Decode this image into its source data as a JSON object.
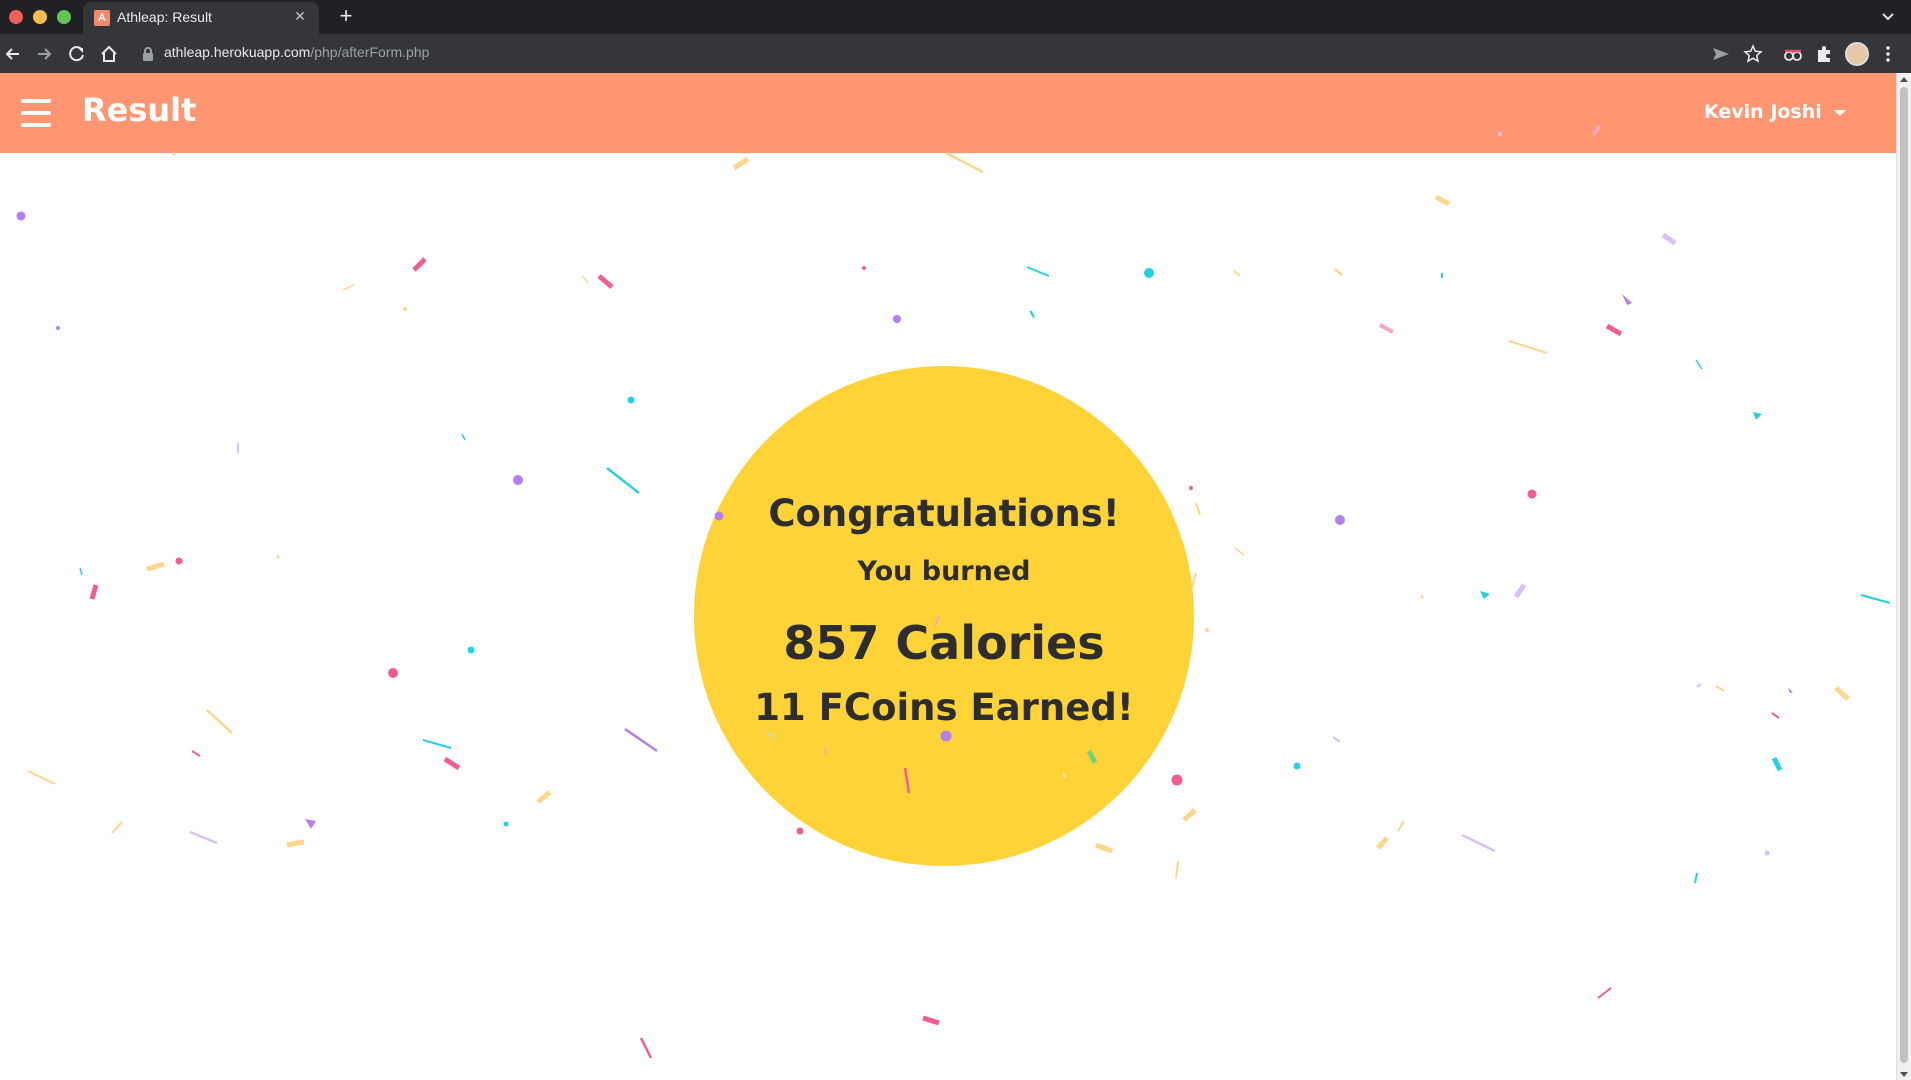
{
  "browser": {
    "tab": {
      "favicon_letter": "A",
      "title": "Athleap: Result",
      "close_symbol": "✕"
    },
    "new_tab_symbol": "+",
    "address": {
      "host": "athleap.herokuapp.com",
      "path": "/php/afterForm.php"
    },
    "toolbar_icons": [
      "back-icon",
      "forward-icon",
      "reload-icon",
      "home-icon",
      "lock-icon",
      "send-icon",
      "star-icon",
      "incognito-extension-icon",
      "extensions-puzzle-icon",
      "profile-avatar",
      "more-menu-icon"
    ]
  },
  "header": {
    "title": "Result",
    "user_name": "Kevin Joshi",
    "menu_icon": "hamburger-icon"
  },
  "result": {
    "congrats": "Congratulations!",
    "burned_label": "You burned",
    "calories": "857 Calories",
    "coins": "11 FCoins Earned!"
  },
  "colors": {
    "header_bg": "#ff9671",
    "circle_bg": "#fed338",
    "text_dark": "#2d2d2d",
    "confetti": [
      "#f25c94",
      "#b47ff0",
      "#26d0e4",
      "#fdd68a",
      "#d7c0f7",
      "#7ad07a"
    ]
  }
}
